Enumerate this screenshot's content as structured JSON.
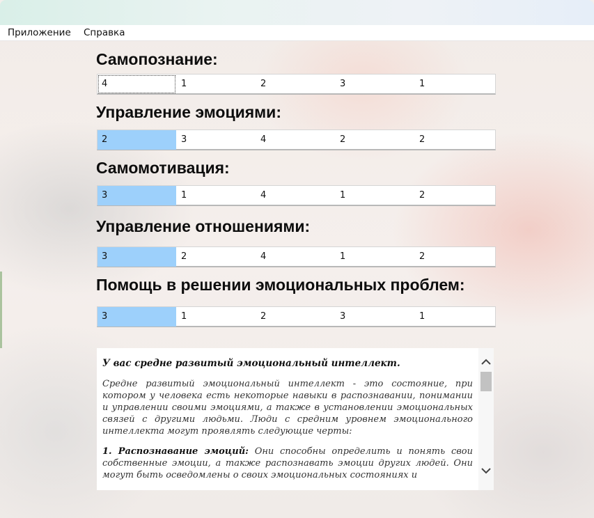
{
  "menu": {
    "items": [
      "Приложение",
      "Справка"
    ]
  },
  "sections": [
    {
      "heading": "Самопознание:",
      "values": [
        "4",
        "1",
        "2",
        "3",
        "1"
      ],
      "selected_index": 0
    },
    {
      "heading": "Управление эмоциями:",
      "values": [
        "2",
        "3",
        "4",
        "2",
        "2"
      ],
      "selected_index": 0
    },
    {
      "heading": "Самомотивация:",
      "values": [
        "3",
        "1",
        "4",
        "1",
        "2"
      ],
      "selected_index": 0
    },
    {
      "heading": "Управление отношениями:",
      "values": [
        "3",
        "2",
        "4",
        "1",
        "2"
      ],
      "selected_index": 0
    },
    {
      "heading": "Помощь в решении эмоциональных проблем:",
      "values": [
        "3",
        "1",
        "2",
        "3",
        "1"
      ],
      "selected_index": 0
    }
  ],
  "result": {
    "title": "У вас средне развитый эмоциональный интеллект.",
    "paragraph1": "Средне развитый эмоциональный интеллект - это состояние, при котором у человека есть некоторые навыки в распознавании, понимании и управлении своими эмоциями, а также в установлении эмоциональных связей с другими людьми. Люди с средним уровнем эмоционального интеллекта могут проявлять следующие черты:",
    "item1_title": "1. Распознавание эмоций:",
    "item1_text": " Они способны определить и понять свои собственные эмоции, а также распознавать эмоции других людей. Они могут быть осведомлены о своих эмоциональных состояниях и"
  },
  "icons": {
    "scroll_up": "chevron-up-icon",
    "scroll_down": "chevron-down-icon"
  }
}
